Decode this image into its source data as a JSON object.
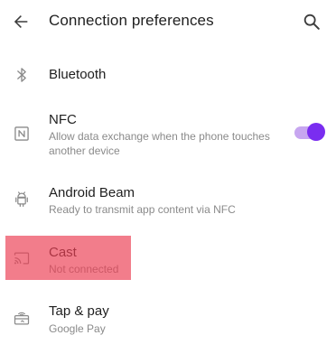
{
  "header": {
    "title": "Connection preferences",
    "back_icon": "arrow-back-icon",
    "search_icon": "search-icon"
  },
  "items": [
    {
      "icon": "bluetooth-icon",
      "label": "Bluetooth",
      "summary": ""
    },
    {
      "icon": "nfc-icon",
      "label": "NFC",
      "summary_line1": "Allow data exchange when the phone touches",
      "summary_line2": "another device",
      "toggle_on": true
    },
    {
      "icon": "android-beam-icon",
      "label": "Android Beam",
      "summary": "Ready to transmit app content via NFC"
    },
    {
      "icon": "cast-icon",
      "label": "Cast",
      "summary": "Not connected"
    },
    {
      "icon": "tap-pay-icon",
      "label": "Tap & pay",
      "summary": "Google Pay"
    }
  ],
  "colors": {
    "accent": "#7a2df0",
    "accent_track": "#c7a6f0",
    "highlight": "#ec4054"
  }
}
